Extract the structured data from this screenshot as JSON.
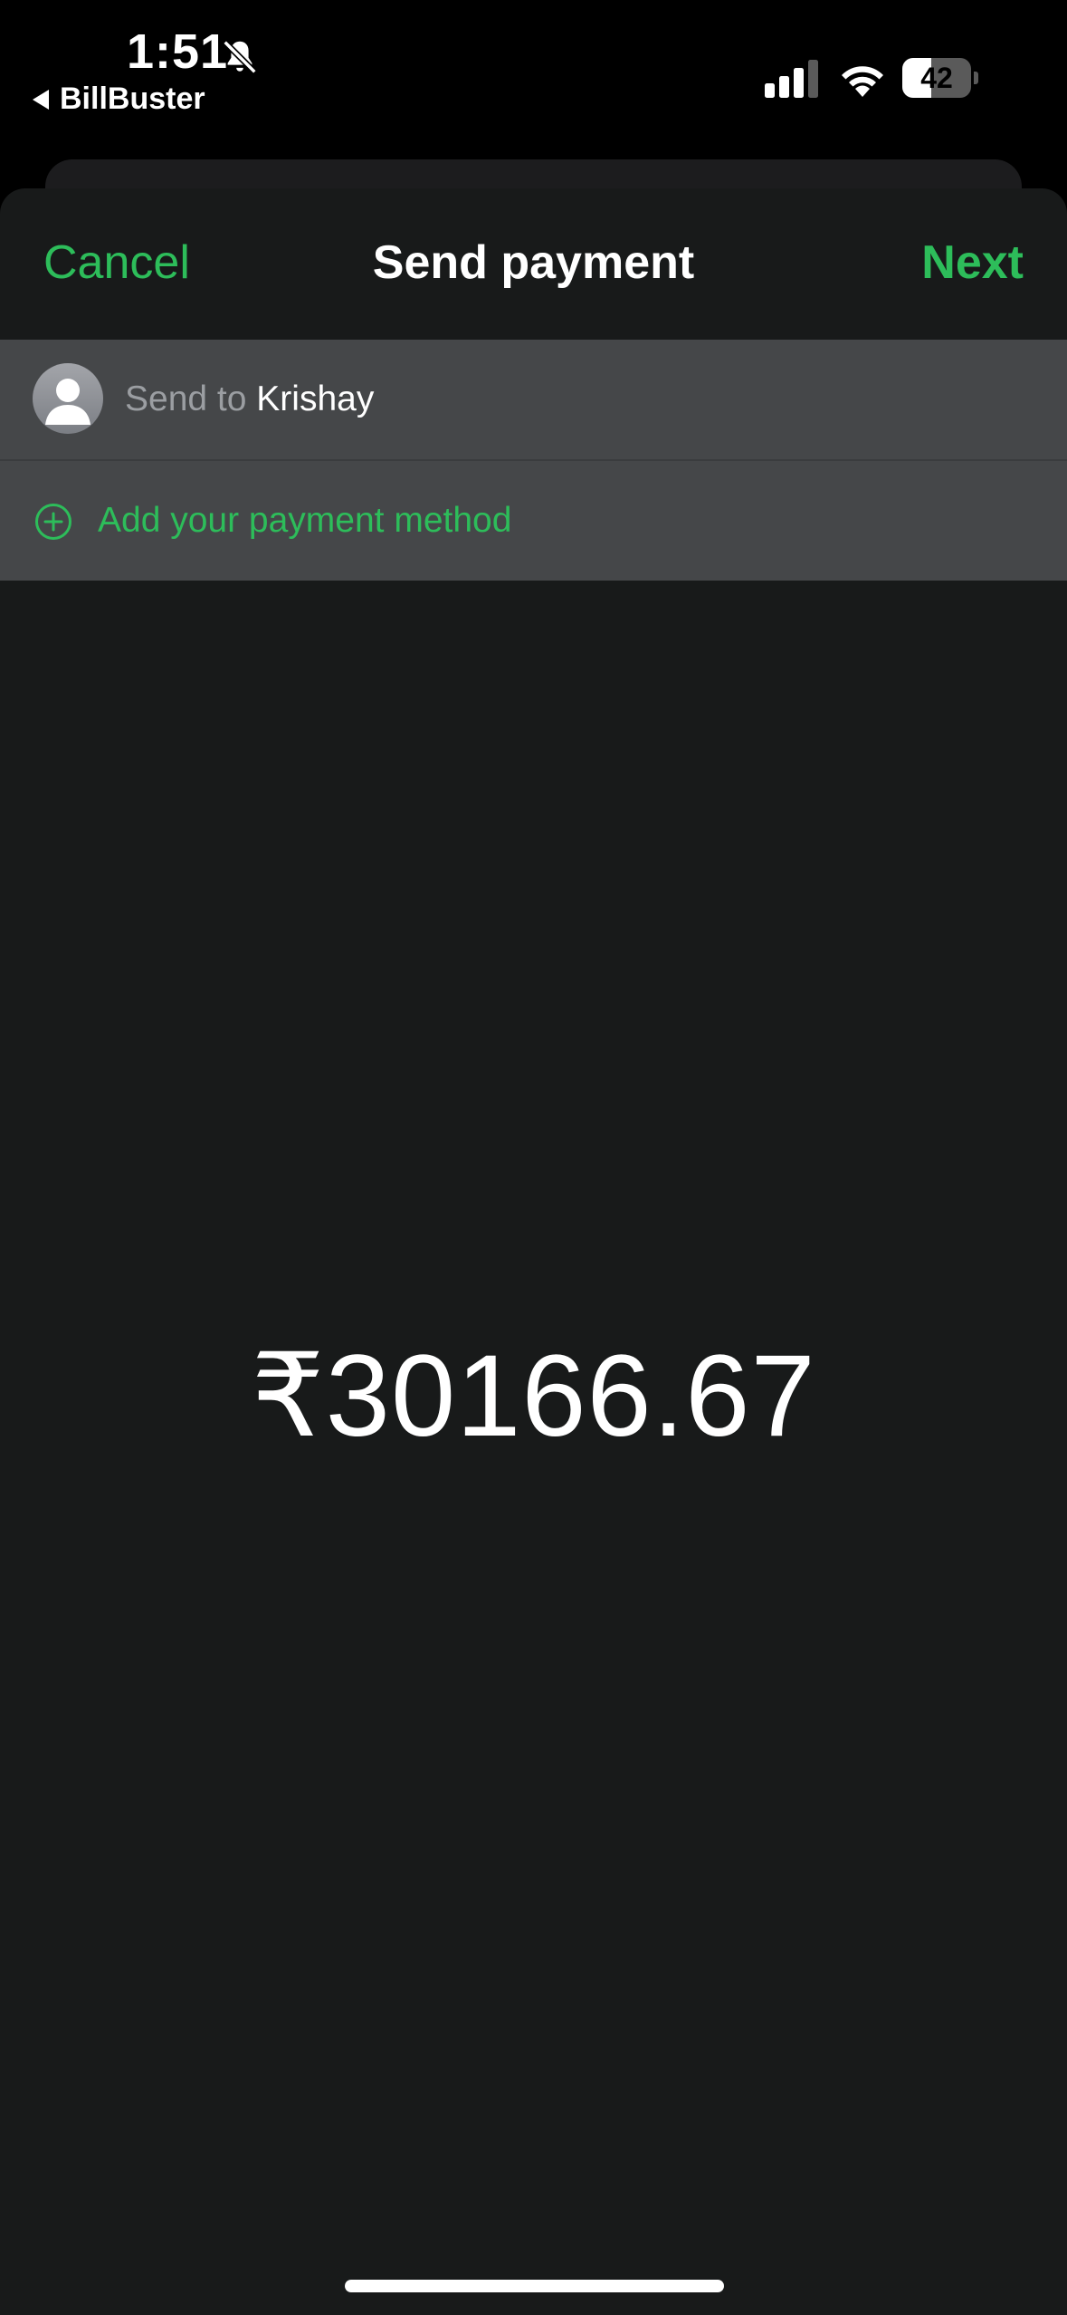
{
  "status_bar": {
    "time": "1:51",
    "back_app": "BillBuster",
    "battery_percent": "42",
    "battery_level": 0.42,
    "icons": [
      "bell-slash-icon",
      "cellular-signal-icon",
      "wifi-icon",
      "battery-icon"
    ]
  },
  "nav": {
    "cancel_label": "Cancel",
    "title": "Send payment",
    "next_label": "Next"
  },
  "recipient": {
    "prefix": "Send to ",
    "name": "Krishay"
  },
  "payment_method": {
    "label": "Add your payment method"
  },
  "amount": "₹30166.67",
  "colors": {
    "accent": "#2dbd5a",
    "sheet_background": "#181a1a",
    "row_background": "#454749"
  }
}
